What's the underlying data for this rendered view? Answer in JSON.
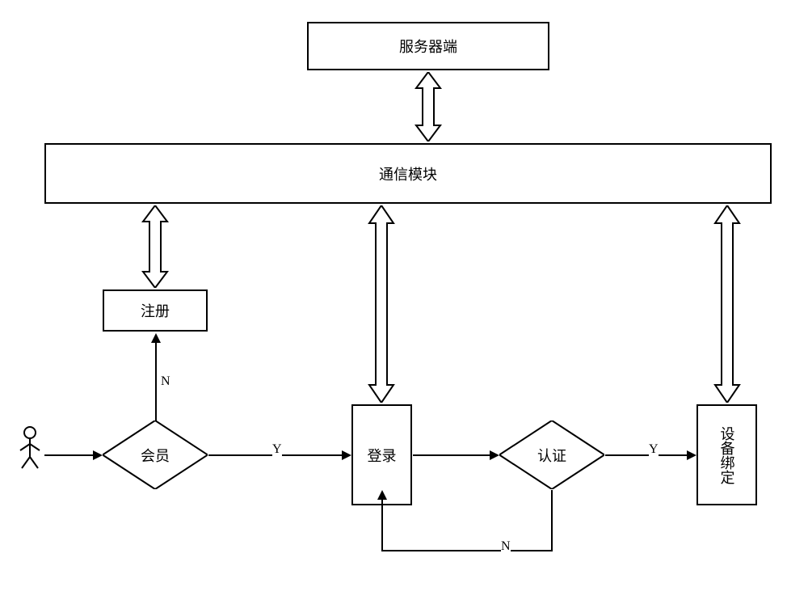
{
  "boxes": {
    "server": "服务器端",
    "comm": "通信模块",
    "register": "注册",
    "login": "登录",
    "bind": "设备绑定"
  },
  "diamonds": {
    "member": "会员",
    "auth": "认证"
  },
  "labels": {
    "yes": "Y",
    "no": "N"
  }
}
